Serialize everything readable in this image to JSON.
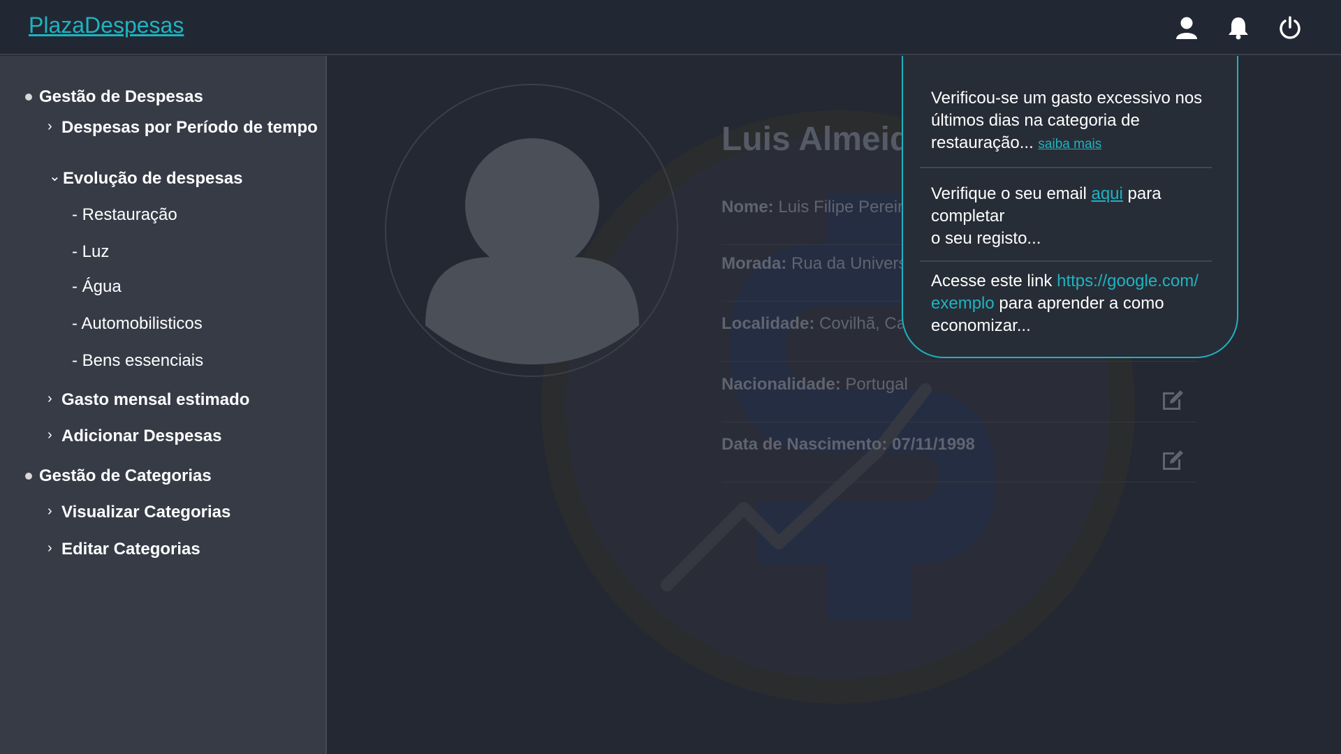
{
  "header": {
    "brand": "PlazaDespesas",
    "icons": [
      "user-icon",
      "bell-icon",
      "power-icon"
    ]
  },
  "sidebar": {
    "sections": [
      {
        "title": "Gestão de Despesas",
        "items": [
          {
            "label": "Despesas por Período de tempo"
          },
          {
            "label": "Evolução de despesas",
            "expanded": true,
            "children": [
              "- Restauração",
              "- Luz",
              "- Água",
              "- Automobilisticos",
              "- Bens essenciais"
            ]
          },
          {
            "label": "Gasto mensal estimado"
          },
          {
            "label": "Adicionar Despesas"
          }
        ]
      },
      {
        "title": "Gestão de Categorias",
        "items": [
          {
            "label": "Visualizar Categorias"
          },
          {
            "label": "Editar Categorias"
          }
        ]
      }
    ]
  },
  "profile": {
    "name": "Luis Almeida",
    "fields": [
      {
        "label": "Nome:",
        "value": "Luis Filipe Pereira"
      },
      {
        "label": "Morada:",
        "value": "Rua da Univers"
      },
      {
        "label": "Localidade:",
        "value": "Covilhã, Caste"
      },
      {
        "label": "Nacionalidade:",
        "value": "Portugal"
      },
      {
        "label": "Data de Nascimento:",
        "value": "07/11/1998"
      }
    ]
  },
  "notifications": [
    {
      "text": "Verificou-se um gasto excessivo nos últimos dias na categoria de restauração...",
      "link": "saiba mais"
    },
    {
      "text_before": "Verifique o seu email",
      "link": "aqui",
      "text_after_1": "para",
      "text_after_2": "completar",
      "text_after_3": "o seu registo..."
    },
    {
      "text_before": "Acesse este link",
      "link_1": "https://google.com/",
      "link_2": "exemplo",
      "text_after": "para aprender a como economizar..."
    }
  ],
  "colors": {
    "accent": "#1fb3c0",
    "background": "#232833",
    "sidebar": "#363b46"
  }
}
